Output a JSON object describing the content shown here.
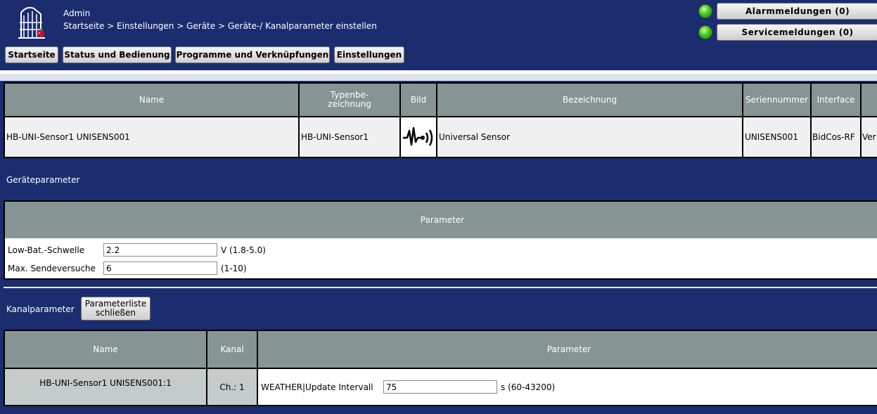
{
  "header": {
    "user": "Admin",
    "breadcrumb": "Startseite > Einstellungen > Geräte > Geräte-/ Kanalparameter einstellen",
    "logo_icon": "homematic-house-logo",
    "nav": [
      "Startseite",
      "Status und Bedienung",
      "Programme und Verknüpfungen",
      "Einstellungen"
    ],
    "alarm_label": "Alarmmeldungen (0)",
    "service_label": "Servicemeldungen (0)",
    "status_color": "#47c41d"
  },
  "device_table": {
    "headers": {
      "name": "Name",
      "type": "Typenbe-\nzeichnung",
      "image": "Bild",
      "description": "Bezeichnung",
      "serial": "Seriennummer",
      "interface": "Interface"
    },
    "row": {
      "name": "HB-UNI-Sensor1 UNISENS001",
      "type": "HB-UNI-Sensor1",
      "image_icon": "sensor-signal-icon",
      "description": "Universal Sensor",
      "serial": "UNISENS001",
      "interface": "BidCos-RF",
      "extra": "Ver"
    }
  },
  "device_params": {
    "title": "Geräteparameter",
    "header": "Parameter",
    "rows": [
      {
        "label": "Low-Bat.-Schwelle",
        "value": "2.2",
        "unit": "V (1.8-5.0)"
      },
      {
        "label": "Max. Sendeversuche",
        "value": "6",
        "unit": "(1-10)"
      }
    ]
  },
  "channel_params": {
    "title": "Kanalparameter",
    "close_button": "Parameterliste\nschließen",
    "headers": {
      "name": "Name",
      "channel": "Kanal",
      "parameter": "Parameter"
    },
    "row": {
      "name": "HB-UNI-Sensor1 UNISENS001:1",
      "channel": "Ch.: 1",
      "param_label": "WEATHER|Update Intervall",
      "param_value": "75",
      "param_unit": "s (60-43200)"
    }
  },
  "colors": {
    "background": "#1b2d6e",
    "table_header": "#879494",
    "row_bg": "#f0f0f0",
    "name_cell_bg": "#c3cbcb"
  }
}
